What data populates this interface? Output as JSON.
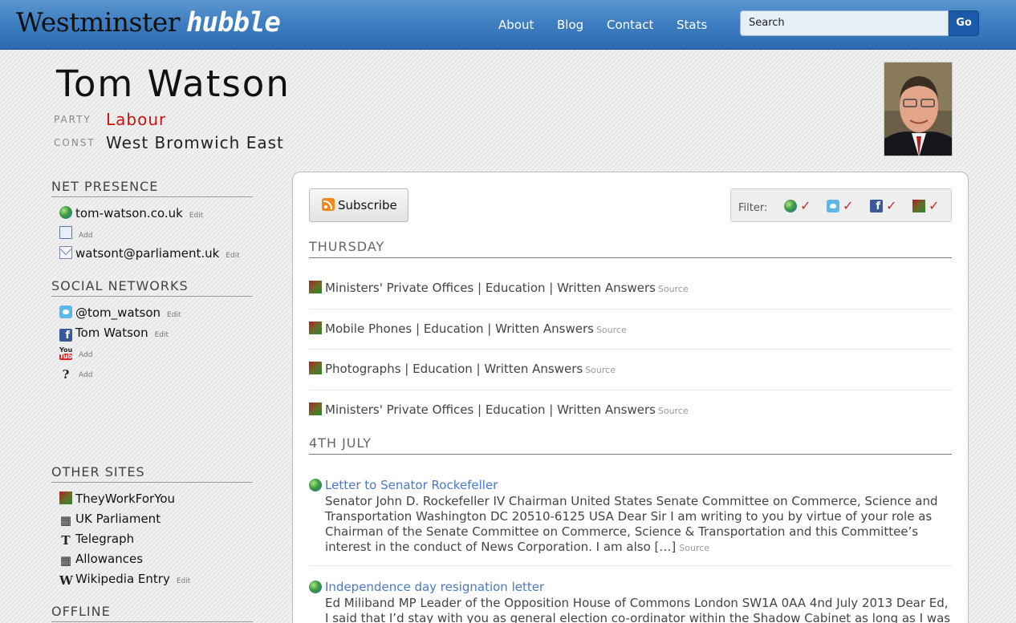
{
  "header": {
    "logo_part1": "Westminster",
    "logo_part2": "hubble",
    "nav": [
      "About",
      "Blog",
      "Contact",
      "Stats"
    ],
    "search_placeholder": "Search",
    "go_label": "Go"
  },
  "profile": {
    "name": "Tom Watson",
    "party_label": "PARTY",
    "party_value": "Labour",
    "const_label": "CONST",
    "const_value": "West Bromwich East",
    "party_color": "#cc1111"
  },
  "sidebar": {
    "net_presence": {
      "heading": "NET PRESENCE",
      "items": [
        {
          "icon": "globe-icon",
          "text": "tom-watson.co.uk",
          "action": "Edit"
        },
        {
          "icon": "book-icon",
          "text": "",
          "action": "Add"
        },
        {
          "icon": "mail-icon",
          "text": "watsont@parliament.uk",
          "action": "Edit"
        }
      ]
    },
    "social_networks": {
      "heading": "SOCIAL NETWORKS",
      "items": [
        {
          "icon": "twitter-icon",
          "text": "@tom_watson",
          "action": "Edit"
        },
        {
          "icon": "facebook-icon",
          "text": "Tom Watson",
          "action": "Edit"
        },
        {
          "icon": "youtube-icon",
          "text": "",
          "action": "Add"
        },
        {
          "icon": "question-icon",
          "text": "",
          "action": "Add"
        }
      ]
    },
    "other_sites": {
      "heading": "OTHER SITES",
      "items": [
        {
          "icon": "theyworkforyou-icon",
          "text": "TheyWorkForYou",
          "action": ""
        },
        {
          "icon": "portcullis-icon",
          "text": "UK Parliament",
          "action": ""
        },
        {
          "icon": "telegraph-icon",
          "text": "Telegraph",
          "action": ""
        },
        {
          "icon": "portcullis-icon",
          "text": "Allowances",
          "action": ""
        },
        {
          "icon": "wikipedia-icon",
          "text": "Wikipedia Entry",
          "action": "Edit"
        }
      ]
    },
    "offline": {
      "heading": "OFFLINE"
    }
  },
  "main": {
    "subscribe_label": "Subscribe",
    "filter_label": "Filter:",
    "filter_items": [
      "globe-icon",
      "twitter-icon",
      "facebook-icon",
      "theyworkforyou-icon"
    ],
    "days": [
      {
        "heading": "THURSDAY",
        "items": [
          {
            "title": "Ministers' Private Offices | Education | Written Answers",
            "source": "Source"
          },
          {
            "title": "Mobile Phones | Education | Written Answers",
            "source": "Source"
          },
          {
            "title": "Photographs | Education | Written Answers",
            "source": "Source"
          },
          {
            "title": "Ministers' Private Offices | Education | Written Answers",
            "source": "Source"
          }
        ]
      },
      {
        "heading": "4TH JULY",
        "entries": [
          {
            "title": "Letter to Senator Rockefeller",
            "body": "Senator John D. Rockefeller IV Chairman United States Senate Committee on Commerce, Science and Transportation Washington DC 20510-6125 USA Dear Sir I am writing to you by virtue of your role as Chairman of the Senate Committee on Commerce, Science & Transportation and this Committee’s interest in the conduct of News Corporation.  I am also […]",
            "source": "Source"
          },
          {
            "title": "Independence day resignation letter",
            "body": "Ed Miliband MP Leader of the Opposition House of Commons London SW1A 0AA   4nd July 2013 Dear Ed, I said that I’d stay with you as general election co-ordinator within the Shadow Cabinet as long as I was",
            "source": ""
          }
        ]
      }
    ]
  }
}
